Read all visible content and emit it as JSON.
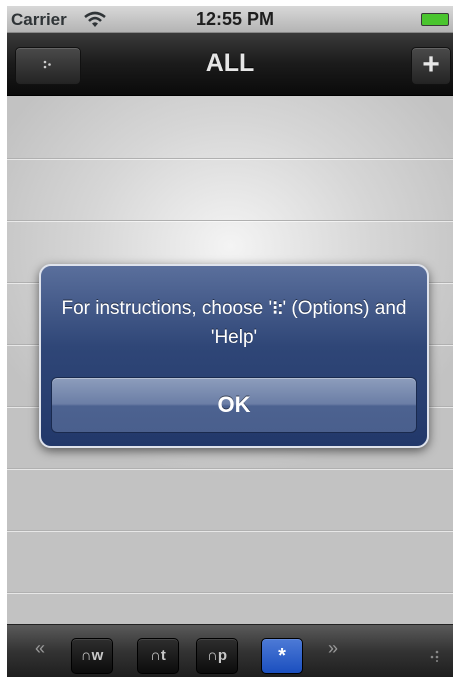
{
  "status_bar": {
    "carrier": "Carrier",
    "time": "12:55 PM",
    "icons": [
      "wifi-icon",
      "battery-icon"
    ],
    "battery_color": "#4ac52e"
  },
  "nav_bar": {
    "title": "ALL",
    "left_button_icon": "options-icon",
    "right_button_label": "+"
  },
  "alert": {
    "message_part1": "For instructions, choose '",
    "message_icon": "⁝:",
    "message_part2": "' (Options) and 'Help'",
    "ok_label": "OK",
    "background_color": "#2f4677"
  },
  "toolbar": {
    "prev_label": "«",
    "next_label": "»",
    "buttons": [
      {
        "label": "∩w",
        "active": false
      },
      {
        "label": "∩t",
        "active": false
      },
      {
        "label": "∩p",
        "active": false
      },
      {
        "label": "*",
        "active": true
      }
    ],
    "active_color": "#1f56c8"
  }
}
